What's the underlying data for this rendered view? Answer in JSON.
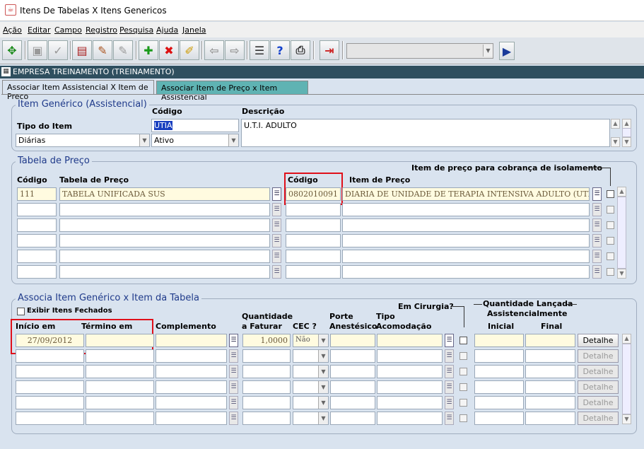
{
  "window": {
    "title": "Itens De Tabelas X Itens Genericos"
  },
  "menu": [
    "Ação",
    "Editar",
    "Campo",
    "Registro",
    "Pesquisa",
    "Ajuda",
    "Janela"
  ],
  "company": "EMPRESA TREINAMENTO (TREINAMENTO)",
  "tabs": [
    "Associar Item Assistencial X Item de Preço",
    "Associar Item de Preço x Item Assistencial"
  ],
  "generic": {
    "title": "Item Genérico (Assistencial)",
    "tipo_label": "Tipo do Item",
    "tipo_value": "Diárias",
    "codigo_label": "Código",
    "codigo_value": "UTIA",
    "status_value": "Ativo",
    "descricao_label": "Descrição",
    "descricao_value": "U.T.I. ADULTO"
  },
  "price_table": {
    "title": "Tabela de Preço",
    "col_codigo": "Código",
    "col_tabela": "Tabela de Preço",
    "col_item_codigo": "Código",
    "col_item": "Item de Preço",
    "isolation_label": "Item de preço para cobrança de isolamento",
    "rows": [
      {
        "codigo": "111",
        "tabela": "TABELA UNIFICADA SUS",
        "item_codigo": "0802010091",
        "item": "DIARIA DE UNIDADE DE TERAPIA INTENSIVA ADULTO (UTI III)"
      },
      {
        "codigo": "",
        "tabela": "",
        "item_codigo": "",
        "item": ""
      },
      {
        "codigo": "",
        "tabela": "",
        "item_codigo": "",
        "item": ""
      },
      {
        "codigo": "",
        "tabela": "",
        "item_codigo": "",
        "item": ""
      },
      {
        "codigo": "",
        "tabela": "",
        "item_codigo": "",
        "item": ""
      },
      {
        "codigo": "",
        "tabela": "",
        "item_codigo": "",
        "item": ""
      }
    ]
  },
  "assoc": {
    "title": "Associa Item Genérico x Item da Tabela",
    "show_closed_label": "Exibir Itens Fechados",
    "col_inicio": "Início em",
    "col_termino": "Término em",
    "col_complemento": "Complemento",
    "col_qtd_1": "Quantidade",
    "col_qtd_2": "a Faturar",
    "col_cec": "CEC ?",
    "col_porte_1": "Porte",
    "col_porte_2": "Anestésico",
    "col_tipo_1": "Tipo",
    "col_tipo_2": "Acomodação",
    "col_cirurgia": "Em Cirurgia?",
    "col_qtd_lancada_1": "Quantidade Lançada",
    "col_qtd_lancada_2": "Assistencialmente",
    "col_inicial": "Inicial",
    "col_final": "Final",
    "detail_label": "Detalhe",
    "rows": [
      {
        "inicio": "27/09/2012",
        "termino": "",
        "qtd": "1,0000",
        "cec": "Não"
      },
      {
        "inicio": "",
        "termino": "",
        "qtd": "",
        "cec": ""
      },
      {
        "inicio": "",
        "termino": "",
        "qtd": "",
        "cec": ""
      },
      {
        "inicio": "",
        "termino": "",
        "qtd": "",
        "cec": ""
      },
      {
        "inicio": "",
        "termino": "",
        "qtd": "",
        "cec": ""
      },
      {
        "inicio": "",
        "termino": "",
        "qtd": "",
        "cec": ""
      }
    ]
  }
}
